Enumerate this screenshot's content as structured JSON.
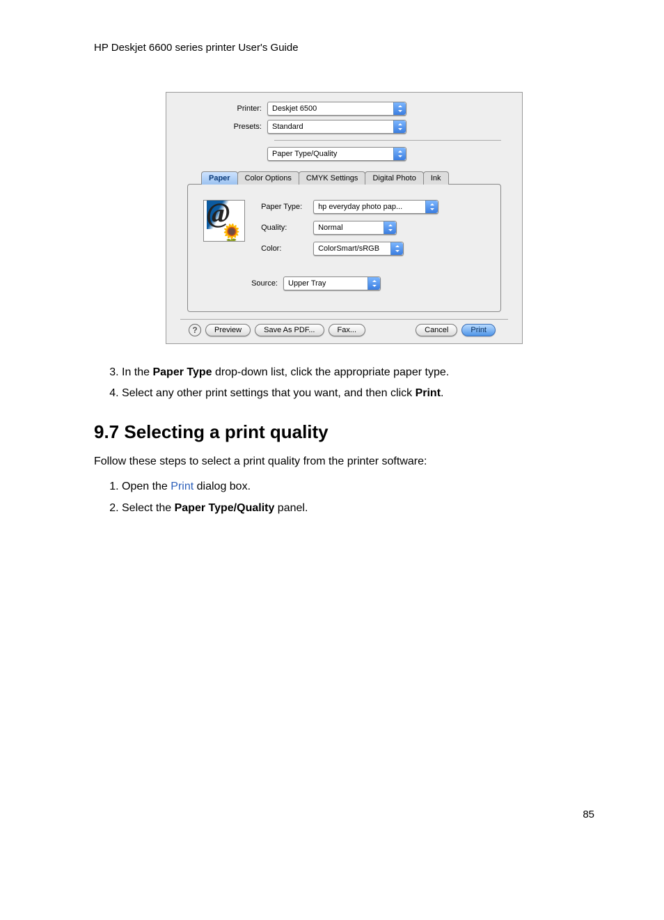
{
  "header": "HP Deskjet 6600 series printer User's Guide",
  "dialog": {
    "printer_label": "Printer:",
    "printer_value": "Deskjet 6500",
    "presets_label": "Presets:",
    "presets_value": "Standard",
    "panel_value": "Paper Type/Quality",
    "tabs": [
      "Paper",
      "Color Options",
      "CMYK Settings",
      "Digital Photo",
      "Ink"
    ],
    "paper_type_label": "Paper Type:",
    "paper_type_value": "hp everyday photo pap...",
    "quality_label": "Quality:",
    "quality_value": "Normal",
    "color_label": "Color:",
    "color_value": "ColorSmart/sRGB",
    "source_label": "Source:",
    "source_value": "Upper Tray",
    "help": "?",
    "buttons": {
      "preview": "Preview",
      "save_pdf": "Save As PDF...",
      "fax": "Fax...",
      "cancel": "Cancel",
      "print": "Print"
    }
  },
  "list1": {
    "item3_pre": "In the ",
    "item3_bold": "Paper Type",
    "item3_post": " drop-down list, click the appropriate paper type.",
    "item4_pre": "Select any other print settings that you want, and then click ",
    "item4_bold": "Print",
    "item4_post": "."
  },
  "section_heading": "9.7  Selecting a print quality",
  "section_intro": "Follow these steps to select a print quality from the printer software:",
  "list2": {
    "item1_pre": "Open the ",
    "item1_link": "Print",
    "item1_post": " dialog box.",
    "item2_pre": "Select the ",
    "item2_bold": "Paper Type/Quality",
    "item2_post": " panel."
  },
  "page_number": "85"
}
